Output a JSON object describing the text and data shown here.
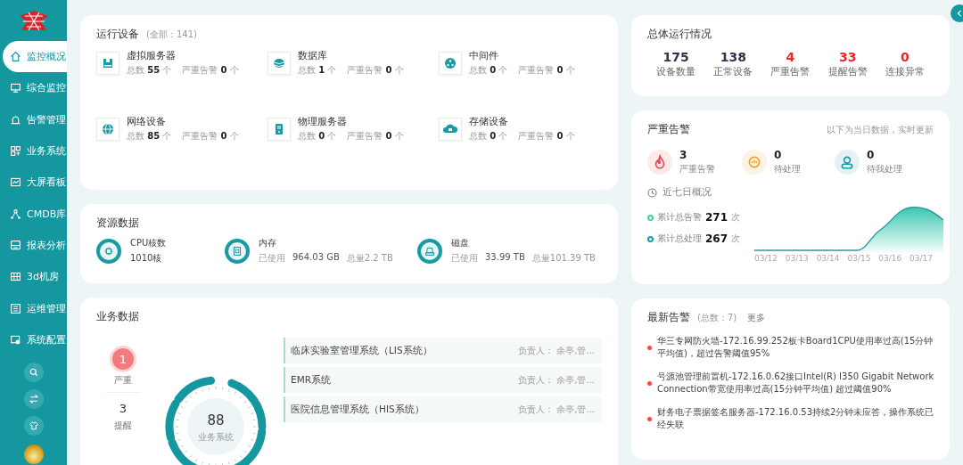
{
  "sidebar": {
    "items": [
      {
        "label": "监控概况",
        "selected": true
      },
      {
        "label": "综合监控",
        "selected": false
      },
      {
        "label": "告警管理",
        "selected": false
      },
      {
        "label": "业务系统",
        "selected": false
      },
      {
        "label": "大屏看板",
        "selected": false
      },
      {
        "label": "CMDB库",
        "selected": false
      },
      {
        "label": "报表分析",
        "selected": false
      },
      {
        "label": "3d机房",
        "selected": false
      },
      {
        "label": "运维管理",
        "selected": false
      },
      {
        "label": "系统配置",
        "selected": false
      }
    ]
  },
  "devices": {
    "title": "运行设备",
    "count": "(全部：141)",
    "items": [
      {
        "name": "虚拟服务器",
        "total": "总数 **55** 个",
        "severe": "严重告警 **0** 个"
      },
      {
        "name": "数据库",
        "total": "总数 **1** 个",
        "severe": "严重告警 **0** 个"
      },
      {
        "name": "中间件",
        "total": "总数 **0** 个",
        "severe": "严重告警 **0** 个"
      },
      {
        "name": "网络设备",
        "total": "总数 **85** 个",
        "severe": "严重告警 **0** 个"
      },
      {
        "name": "物理服务器",
        "total": "总数 **0** 个",
        "severe": "严重告警 **0** 个"
      },
      {
        "name": "存储设备",
        "total": "总数 **0** 个",
        "severe": "严重告警 **0** 个"
      }
    ]
  },
  "resources": {
    "title": "资源数据",
    "items": [
      {
        "name": "CPU核数",
        "value": "1010核"
      },
      {
        "name": "内存",
        "used_label": "已使用",
        "used": "964.03 GB",
        "total": "总量2.2 TB"
      },
      {
        "name": "磁盘",
        "used_label": "已使用",
        "used": "33.99 TB",
        "total": "总量101.39 TB"
      }
    ]
  },
  "business": {
    "title": "业务数据",
    "stats": [
      {
        "value": "1",
        "label": "严重",
        "kind": "badge"
      },
      {
        "value": "3",
        "label": "提醒",
        "kind": "plain"
      }
    ],
    "gauge": {
      "value": "88",
      "label": "业务系统"
    },
    "systems": [
      {
        "name": "临床实验室管理系统（LIS系统）",
        "owner": "负责人： 余亭,管..."
      },
      {
        "name": "EMR系统",
        "owner": "负责人： 余亭,管..."
      },
      {
        "name": "医院信息管理系统（HIS系统）",
        "owner": "负责人： 余亭,管..."
      }
    ]
  },
  "overview": {
    "title": "总体运行情况",
    "stats": [
      {
        "value": "175",
        "label": "设备数量",
        "color": "#2b3450"
      },
      {
        "value": "138",
        "label": "正常设备",
        "color": "#2b3450"
      },
      {
        "value": "4",
        "label": "严重告警",
        "color": "#e8262b"
      },
      {
        "value": "33",
        "label": "提醒告警",
        "color": "#e8262b"
      },
      {
        "value": "0",
        "label": "连接异常",
        "color": "#e8262b"
      }
    ]
  },
  "severe": {
    "title": "严重告警",
    "note": "以下为当日数据，实时更新",
    "stats": [
      {
        "value": "3",
        "label": "严重告警",
        "color": "#e8474c"
      },
      {
        "value": "0",
        "label": "待处理",
        "color": "#f0a020"
      },
      {
        "value": "0",
        "label": "待我处理",
        "color": "#1a9aa5"
      }
    ],
    "week_title": "近七日概况",
    "totals": [
      {
        "label": "累计总告警",
        "value": "271",
        "unit": "次",
        "color": "#3ccfb0"
      },
      {
        "label": "累计总处理",
        "value": "267",
        "unit": "次",
        "color": "#1a9aa5"
      }
    ],
    "x_labels": [
      "03/12",
      "03/13",
      "03/14",
      "03/15",
      "03/16",
      "03/17"
    ]
  },
  "latest": {
    "title": "最新告警",
    "count": "(总数：7)",
    "more": "更多",
    "items": [
      "华三专网防火墙-172.16.99.252板卡Board1CPU使用率过高(15分钟平均值)，超过告警阈值95%",
      "号源池管理前置机-172.16.0.62接口Intel(R) I350 Gigabit Network Connection带宽使用率过高(15分钟平均值) 超过阈值90%",
      "财务电子票据签名服务器-172.16.0.53持续2分钟未应答，操作系统已经失联"
    ]
  }
}
